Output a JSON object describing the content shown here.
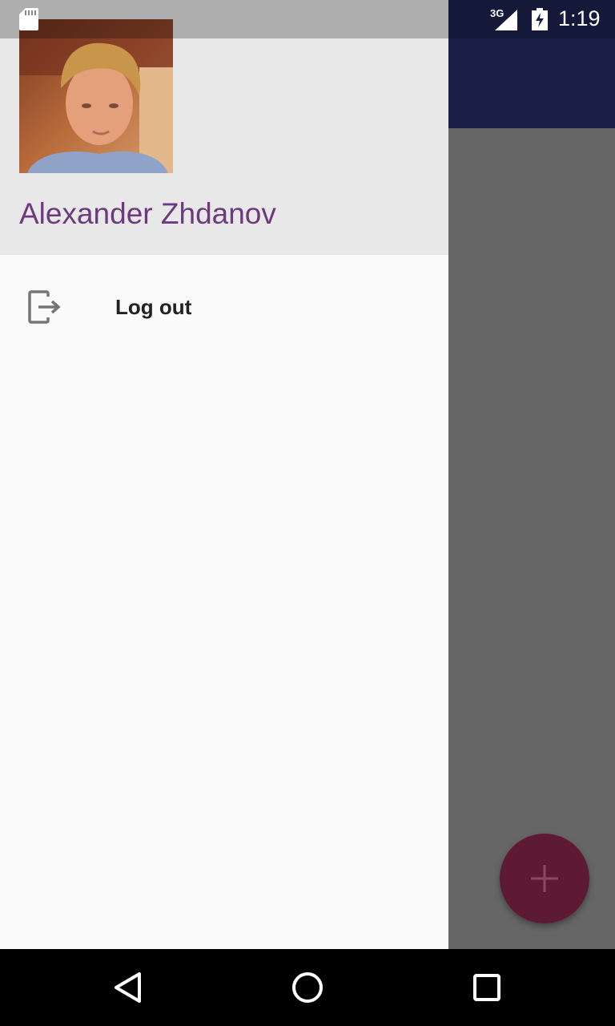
{
  "status_bar": {
    "network_type": "3G",
    "time": "1:19",
    "icons": [
      "sd-card-icon",
      "signal-icon",
      "battery-charging-icon"
    ]
  },
  "app": {
    "toolbar_color": "#1a1f48",
    "fab": {
      "icon": "plus-icon",
      "color": "#5e1a33"
    }
  },
  "drawer": {
    "header": {
      "user_name": "Alexander Zhdanov",
      "name_color": "#6e3a7f",
      "avatar": "user-photo"
    },
    "menu": [
      {
        "icon": "logout-icon",
        "label": "Log out"
      }
    ]
  },
  "nav_bar": {
    "buttons": [
      "back-icon",
      "home-icon",
      "recents-icon"
    ]
  }
}
